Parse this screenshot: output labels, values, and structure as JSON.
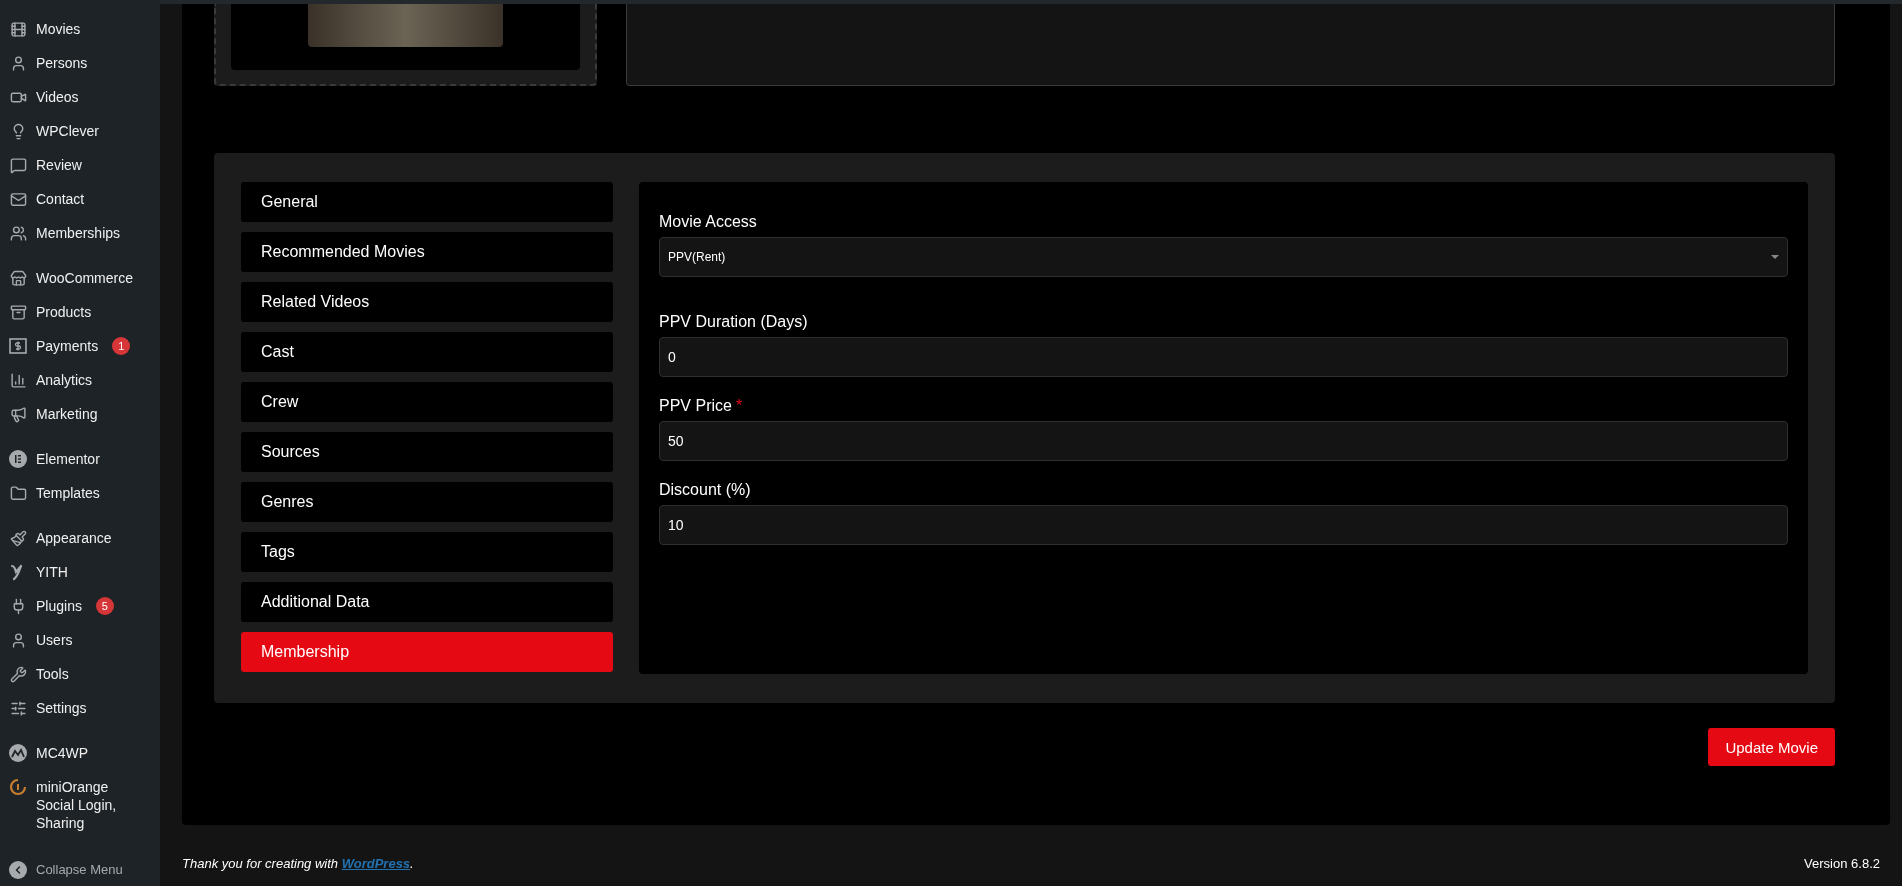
{
  "sidebar": {
    "groups": [
      [
        {
          "label": "Movies"
        },
        {
          "label": "Persons"
        },
        {
          "label": "Videos"
        },
        {
          "label": "WPClever"
        },
        {
          "label": "Review"
        },
        {
          "label": "Contact"
        },
        {
          "label": "Memberships"
        }
      ],
      [
        {
          "label": "WooCommerce"
        },
        {
          "label": "Products"
        },
        {
          "label": "Payments",
          "badge": "1"
        },
        {
          "label": "Analytics"
        },
        {
          "label": "Marketing"
        }
      ],
      [
        {
          "label": "Elementor"
        },
        {
          "label": "Templates"
        }
      ],
      [
        {
          "label": "Appearance"
        },
        {
          "label": "YITH"
        },
        {
          "label": "Plugins",
          "badge": "5"
        },
        {
          "label": "Users"
        },
        {
          "label": "Tools"
        },
        {
          "label": "Settings"
        }
      ],
      [
        {
          "label": "MC4WP"
        },
        {
          "label": "miniOrange Social Login, Sharing"
        }
      ]
    ],
    "collapse": "Collapse Menu"
  },
  "tabs": [
    {
      "label": "General",
      "selected": false
    },
    {
      "label": "Recommended Movies",
      "selected": false
    },
    {
      "label": "Related Videos",
      "selected": false
    },
    {
      "label": "Cast",
      "selected": false
    },
    {
      "label": "Crew",
      "selected": false
    },
    {
      "label": "Sources",
      "selected": false
    },
    {
      "label": "Genres",
      "selected": false
    },
    {
      "label": "Tags",
      "selected": false
    },
    {
      "label": "Additional Data",
      "selected": false
    },
    {
      "label": "Membership",
      "selected": true
    }
  ],
  "fields": [
    {
      "kind": "select",
      "label": "Movie Access",
      "value": "PPV(Rent)"
    },
    {
      "kind": "input",
      "label": "PPV Duration (Days)",
      "value": "0"
    },
    {
      "kind": "input",
      "label": "PPV Price",
      "value": "50",
      "required_mark": "*"
    },
    {
      "kind": "input",
      "label": "Discount (%)",
      "value": "10"
    }
  ],
  "update_button": "Update Movie",
  "footer": {
    "text_before": "Thank you for creating with ",
    "link": "WordPress",
    "text_after": ".",
    "version": "Version 6.8.2"
  }
}
